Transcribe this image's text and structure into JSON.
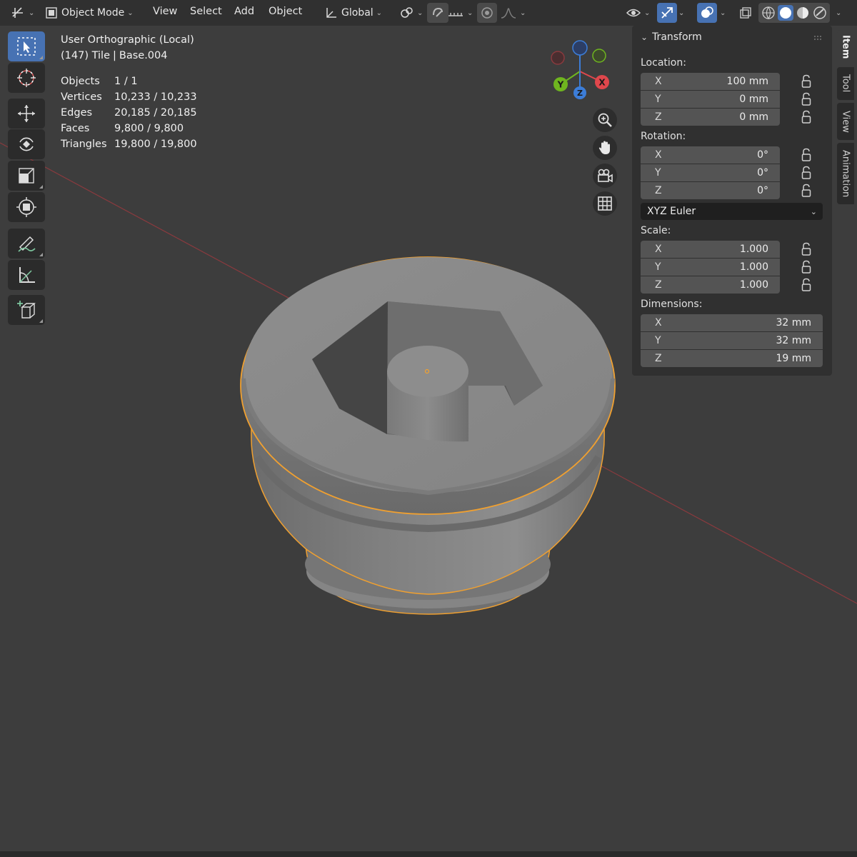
{
  "header": {
    "mode_label": "Object Mode",
    "menus": [
      "View",
      "Select",
      "Add",
      "Object"
    ],
    "transform_orientation": "Global"
  },
  "viewport": {
    "view_name": "User Orthographic (Local)",
    "frame": "(147)",
    "collection": "Tile",
    "object": "Base.004",
    "stats": [
      {
        "label": "Objects",
        "value": "1 / 1"
      },
      {
        "label": "Vertices",
        "value": "10,233 / 10,233"
      },
      {
        "label": "Edges",
        "value": "20,185 / 20,185"
      },
      {
        "label": "Faces",
        "value": "9,800 / 9,800"
      },
      {
        "label": "Triangles",
        "value": "19,800 / 19,800"
      }
    ],
    "gizmo": {
      "x": "X",
      "y": "Y",
      "z": "Z"
    }
  },
  "panel": {
    "title": "Transform",
    "location_label": "Location:",
    "location": [
      {
        "axis": "X",
        "value": "100 mm"
      },
      {
        "axis": "Y",
        "value": "0 mm"
      },
      {
        "axis": "Z",
        "value": "0 mm"
      }
    ],
    "rotation_label": "Rotation:",
    "rotation": [
      {
        "axis": "X",
        "value": "0°"
      },
      {
        "axis": "Y",
        "value": "0°"
      },
      {
        "axis": "Z",
        "value": "0°"
      }
    ],
    "rotation_mode": "XYZ Euler",
    "scale_label": "Scale:",
    "scale": [
      {
        "axis": "X",
        "value": "1.000"
      },
      {
        "axis": "Y",
        "value": "1.000"
      },
      {
        "axis": "Z",
        "value": "1.000"
      }
    ],
    "dimensions_label": "Dimensions:",
    "dimensions": [
      {
        "axis": "X",
        "value": "32 mm"
      },
      {
        "axis": "Y",
        "value": "32 mm"
      },
      {
        "axis": "Z",
        "value": "19 mm"
      }
    ]
  },
  "side_tabs": [
    "Item",
    "Tool",
    "View",
    "Animation"
  ],
  "colors": {
    "header_bg": "#303030",
    "viewport_bg": "#3d3d3d",
    "accent": "#4772b3",
    "selection_outline": "#f0a030",
    "axis_x": "#e0474c",
    "axis_y": "#6fb51f",
    "axis_z": "#3c7dd8"
  }
}
